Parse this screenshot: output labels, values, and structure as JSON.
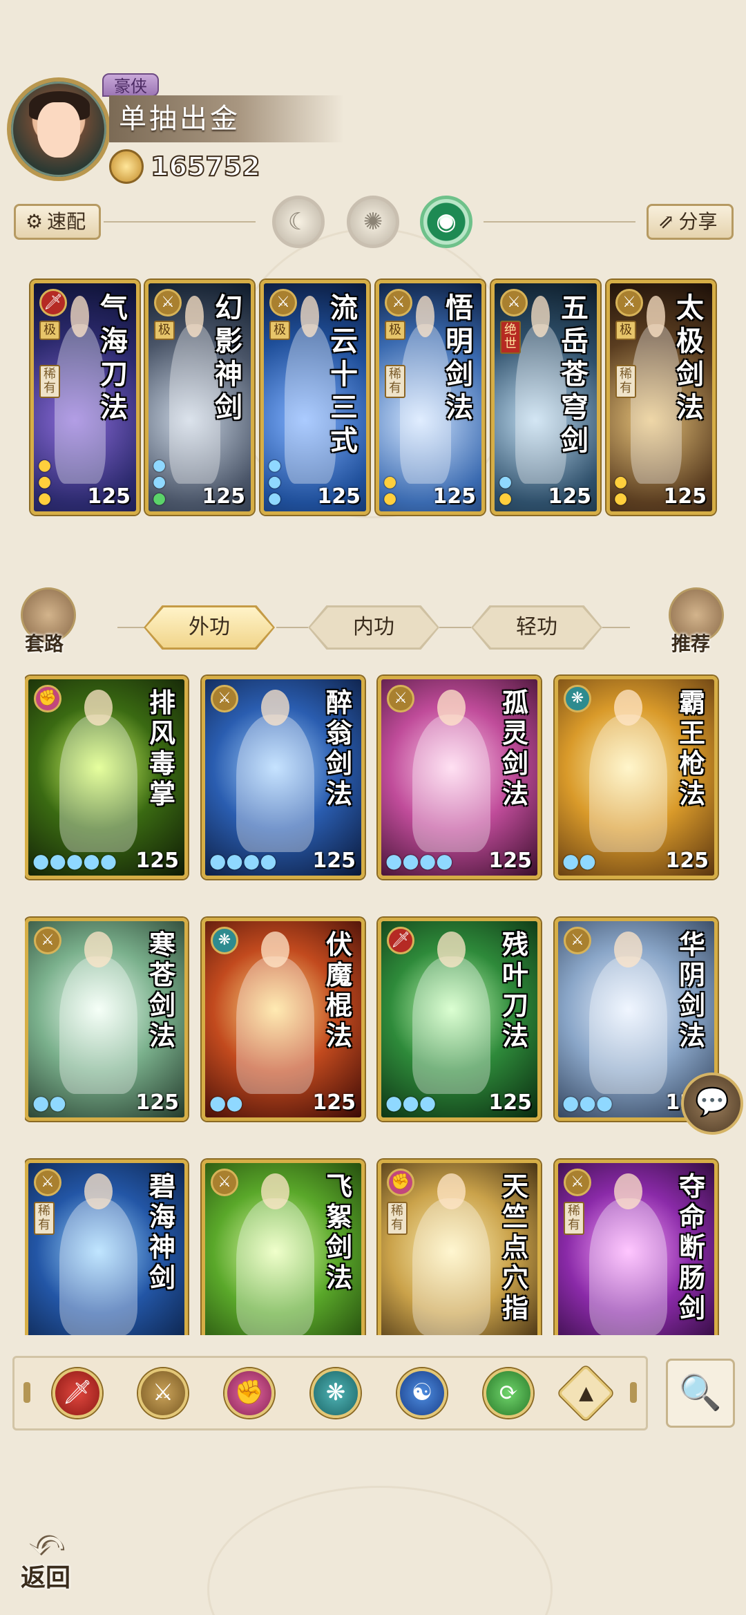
{
  "player": {
    "rank": "豪侠",
    "title": "单抽出金",
    "coins": "165752"
  },
  "controls": {
    "speed_label": "速配",
    "share_label": "分享"
  },
  "equipped": [
    {
      "title": "气海刀法",
      "level": "125",
      "tag": "极",
      "tag2": "稀有",
      "element": "red",
      "pips": "y y y"
    },
    {
      "title": "幻影神剑",
      "level": "125",
      "tag": "极",
      "tag2": "",
      "element": "gold",
      "pips": "b b g"
    },
    {
      "title": "流云十三式",
      "level": "125",
      "tag": "极",
      "tag2": "",
      "element": "gold",
      "pips": "b b b"
    },
    {
      "title": "悟明剑法",
      "level": "125",
      "tag": "极",
      "tag2": "稀有",
      "element": "gold",
      "pips": "y y"
    },
    {
      "title": "五岳苍穹剑",
      "level": "125",
      "tag": "绝世",
      "tag2": "",
      "element": "gold",
      "pips": "b y"
    },
    {
      "title": "太极剑法",
      "level": "125",
      "tag": "极",
      "tag2": "稀有",
      "element": "gold",
      "pips": "y y"
    }
  ],
  "categories": {
    "routines": "套路",
    "recommend": "推荐",
    "tabs": [
      "外功",
      "内功",
      "轻功"
    ]
  },
  "skills": [
    {
      "title": "排风毒掌",
      "level": "125",
      "pips": "●●●●●",
      "element": "pink",
      "tag": ""
    },
    {
      "title": "醉翁剑法",
      "level": "125",
      "pips": "●●●●",
      "element": "gold",
      "tag": ""
    },
    {
      "title": "孤灵剑法",
      "level": "125",
      "pips": "●●●●",
      "element": "gold",
      "tag": ""
    },
    {
      "title": "霸王枪法",
      "level": "125",
      "pips": "●●",
      "element": "teal",
      "tag": ""
    },
    {
      "title": "寒苍剑法",
      "level": "125",
      "pips": "●●",
      "element": "gold",
      "tag": ""
    },
    {
      "title": "伏魔棍法",
      "level": "125",
      "pips": "●●",
      "element": "teal",
      "tag": ""
    },
    {
      "title": "残叶刀法",
      "level": "125",
      "pips": "●●●",
      "element": "red",
      "tag": ""
    },
    {
      "title": "华阴剑法",
      "level": "125",
      "pips": "●●●",
      "element": "gold",
      "tag": ""
    },
    {
      "title": "碧海神剑",
      "level": "",
      "pips": "",
      "element": "gold",
      "tag": "稀有"
    },
    {
      "title": "飞絮剑法",
      "level": "",
      "pips": "",
      "element": "gold",
      "tag": ""
    },
    {
      "title": "天竺点穴指",
      "level": "",
      "pips": "",
      "element": "pink",
      "tag": "稀有"
    },
    {
      "title": "夺命断肠剑",
      "level": "",
      "pips": "",
      "element": "gold",
      "tag": "稀有"
    }
  ],
  "colors": {
    "red": "#b52a24",
    "gold": "#a9802f",
    "pink": "#c2477d",
    "teal": "#2e8b8f"
  }
}
